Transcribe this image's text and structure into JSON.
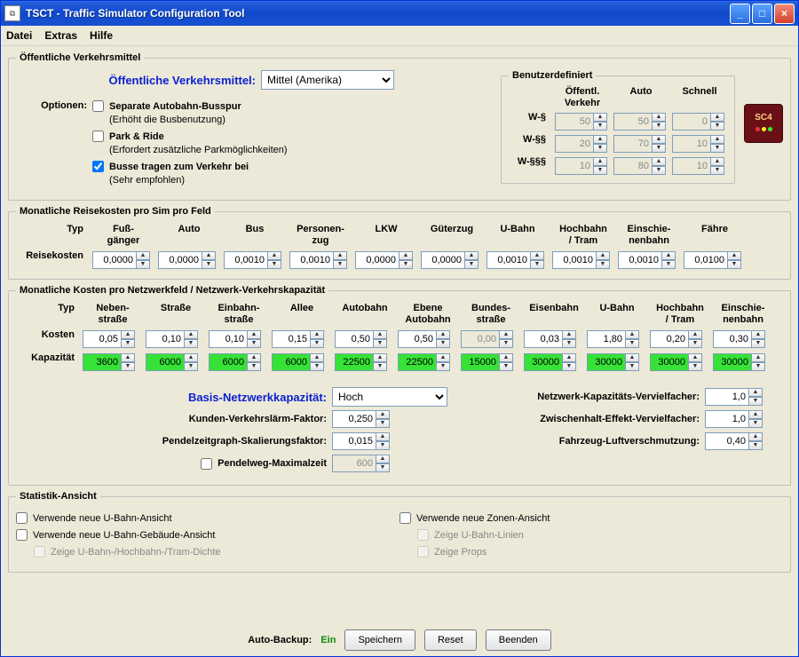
{
  "window": {
    "title": "TSCT - Traffic Simulator Configuration Tool",
    "min": "_",
    "max": "□",
    "close": "×"
  },
  "menu": {
    "file": "Datei",
    "extras": "Extras",
    "help": "Hilfe"
  },
  "transit": {
    "legend": "Öffentliche Verkehrsmittel",
    "label": "Öffentliche Verkehrsmittel:",
    "value": "Mittel (Amerika)",
    "options_label": "Optionen:",
    "opts": [
      {
        "l": "Separate Autobahn-Busspur",
        "s": "(Erhöht die Busbenutzung)",
        "c": false
      },
      {
        "l": "Park & Ride",
        "s": "(Erfordert zusätzliche Parkmöglichkeiten)",
        "c": false
      },
      {
        "l": "Busse tragen zum Verkehr bei",
        "s": "(Sehr empfohlen)",
        "c": true
      }
    ],
    "custom": {
      "legend": "Benutzerdefiniert",
      "cols": {
        "a": "Öffentl.\nVerkehr",
        "b": "Auto",
        "c": "Schnell"
      },
      "rows": [
        {
          "l": "W-§",
          "a": "50",
          "b": "50",
          "c": "0"
        },
        {
          "l": "W-§§",
          "a": "20",
          "b": "70",
          "c": "10"
        },
        {
          "l": "W-§§§",
          "a": "10",
          "b": "80",
          "c": "10"
        }
      ]
    },
    "sc4": "SC4"
  },
  "travel": {
    "legend": "Monatliche Reisekosten pro Sim pro Feld",
    "head": {
      "typ": "Typ",
      "r": "Reisekosten",
      "cols": [
        "Fuß-\ngänger",
        "Auto",
        "Bus",
        "Personen-\nzug",
        "LKW",
        "Güterzug",
        "U-Bahn",
        "Hochbahn\n/ Tram",
        "Einschie-\nnenbahn",
        "Fähre"
      ]
    },
    "vals": [
      "0,0000",
      "0,0000",
      "0,0010",
      "0,0010",
      "0,0000",
      "0,0000",
      "0,0010",
      "0,0010",
      "0,0010",
      "0,0100"
    ]
  },
  "net": {
    "legend": "Monatliche Kosten pro Netzwerkfeld / Netzwerk-Verkehrskapazität",
    "typ": "Typ",
    "cost": "Kosten",
    "cap": "Kapazität",
    "cols": [
      "Neben-\nstraße",
      "Straße",
      "Einbahn-\nstraße",
      "Allee",
      "Autobahn",
      "Ebene\nAutobahn",
      "Bundes-\nstraße",
      "Eisenbahn",
      "U-Bahn",
      "Hochbahn\n/ Tram",
      "Einschie-\nnenbahn"
    ],
    "costs": [
      "0,05",
      "0,10",
      "0,10",
      "0,15",
      "0,50",
      "0,50",
      "0,00",
      "0,03",
      "1,80",
      "0,20",
      "0,30"
    ],
    "caps": [
      "3600",
      "6000",
      "6000",
      "6000",
      "22500",
      "22500",
      "15000",
      "30000",
      "30000",
      "30000",
      "30000"
    ],
    "basecap_lbl": "Basis-Netzwerkkapazität:",
    "basecap": "Hoch",
    "noise_lbl": "Kunden-Verkehrslärm-Faktor:",
    "noise": "0,250",
    "comm_lbl": "Pendelzeitgraph-Skalierungsfaktor:",
    "comm": "0,015",
    "maxcomm_lbl": "Pendelweg-Maximalzeit",
    "maxcomm": "600",
    "mult_lbl": "Netzwerk-Kapazitäts-Vervielfacher:",
    "mult": "1,0",
    "stop_lbl": "Zwischenhalt-Effekt-Vervielfacher:",
    "stop": "1,0",
    "poll_lbl": "Fahrzeug-Luftverschmutzung:",
    "poll": "0,40"
  },
  "stats": {
    "legend": "Statistik-Ansicht",
    "a": "Verwende neue U-Bahn-Ansicht",
    "b": "Verwende neue U-Bahn-Gebäude-Ansicht",
    "c": "Zeige U-Bahn-/Hochbahn-/Tram-Dichte",
    "d": "Verwende neue Zonen-Ansicht",
    "e": "Zeige U-Bahn-Linien",
    "f": "Zeige Props"
  },
  "footer": {
    "autobackup": "Auto-Backup:",
    "ein": "Ein",
    "save": "Speichern",
    "reset": "Reset",
    "exit": "Beenden"
  }
}
